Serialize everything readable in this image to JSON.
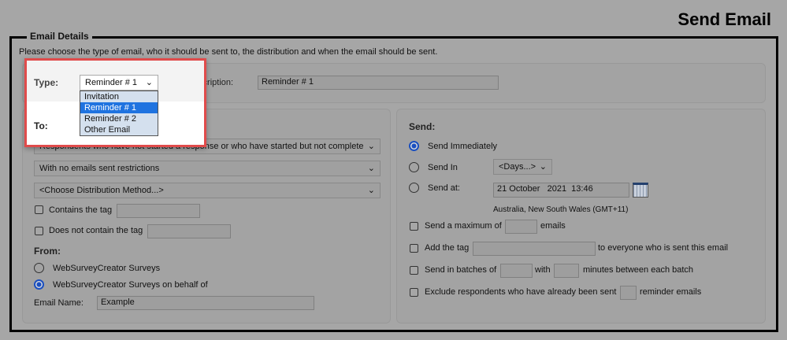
{
  "page_title": "Send Email",
  "section_legend": "Email Details",
  "instructions": "Please choose the type of email, who it should be sent to, the distribution and when the email should be sent.",
  "type": {
    "label": "Type:",
    "value": "Reminder # 1",
    "options": [
      "Invitation",
      "Reminder # 1",
      "Reminder # 2",
      "Other Email"
    ],
    "selected_index": 1
  },
  "description": {
    "label": "Description:",
    "value": "Reminder # 1"
  },
  "to": {
    "label": "To:",
    "recipients": "Respondents who have not started a response or who have started but not complete",
    "restrictions": "With no emails sent restrictions",
    "distribution": "<Choose Distribution Method...>",
    "contains_tag": "Contains the tag",
    "not_contains_tag": "Does not contain the tag"
  },
  "from": {
    "label": "From:",
    "option1": "WebSurveyCreator Surveys",
    "option2": "WebSurveyCreator Surveys on behalf of",
    "selected": 2,
    "email_name_label": "Email Name:",
    "email_name": "Example"
  },
  "send": {
    "label": "Send:",
    "immediately": "Send Immediately",
    "send_in": "Send In",
    "days": "<Days...>",
    "send_at": "Send at:",
    "datetime": "21 October   2021  13:46",
    "timezone": "Australia, New South Wales (GMT+11)",
    "selected": "immediately",
    "max_pre": "Send a maximum of",
    "max_post": "emails",
    "tag_pre": "Add the tag",
    "tag_post": "to everyone who is sent this email",
    "batch_pre": "Send in batches of",
    "batch_mid": "with",
    "batch_post": "minutes between each batch",
    "excl_pre": "Exclude respondents who have already been sent",
    "excl_post": "reminder emails"
  },
  "colors": {
    "highlight": "#e04b4b",
    "accent": "#1f73e0"
  }
}
